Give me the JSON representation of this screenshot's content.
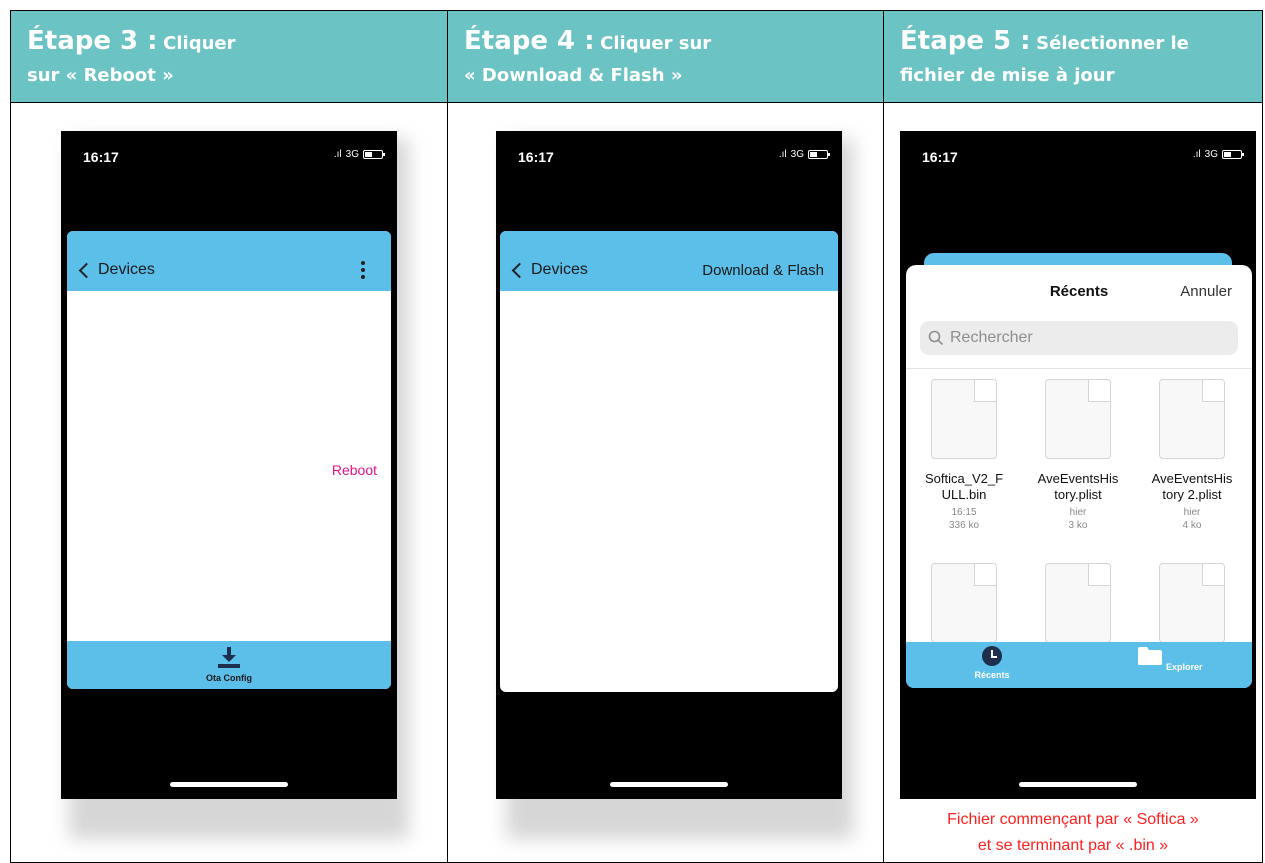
{
  "steps": [
    {
      "step": "Étape 3 :",
      "action": "Cliquer",
      "action_line2": "sur « Reboot »",
      "phone": {
        "time": "16:17",
        "network": "3G",
        "back_label": "Devices",
        "right_action": "Reboot",
        "bottom_label": "Ota Config"
      }
    },
    {
      "step": "Étape 4 :",
      "action": "Cliquer sur",
      "action_line2": "« Download & Flash »",
      "phone": {
        "time": "16:17",
        "network": "3G",
        "back_label": "Devices",
        "nav_action": "Download & Flash"
      }
    },
    {
      "step": "Étape 5 :",
      "action": "Sélectionner le",
      "action_line2": "fichier de mise à jour",
      "phone": {
        "time": "16:17",
        "network": "3G",
        "sheet_title": "Récents",
        "cancel_label": "Annuler",
        "search_placeholder": "Rechercher",
        "files": [
          {
            "name_line1": "Softica_V2_F",
            "name_line2": "ULL.bin",
            "date": "16:15",
            "size": "336 ko"
          },
          {
            "name_line1": "AveEventsHis",
            "name_line2": "tory.plist",
            "date": "hier",
            "size": "3 ko"
          },
          {
            "name_line1": "AveEventsHis",
            "name_line2": "tory 2.plist",
            "date": "hier",
            "size": "4 ko"
          }
        ],
        "tabs": [
          {
            "label": "Récents",
            "icon": "clock-icon"
          },
          {
            "label": "Explorer",
            "icon": "folder-icon"
          }
        ]
      },
      "note_line1": "Fichier commençant par « Softica »",
      "note_line2": "et se terminant par « .bin »"
    }
  ],
  "colors": {
    "header_bg": "#6cc3c3",
    "app_bar": "#5bbfe9",
    "reboot_text": "#e8158a",
    "note_text": "#ff1f1f"
  }
}
